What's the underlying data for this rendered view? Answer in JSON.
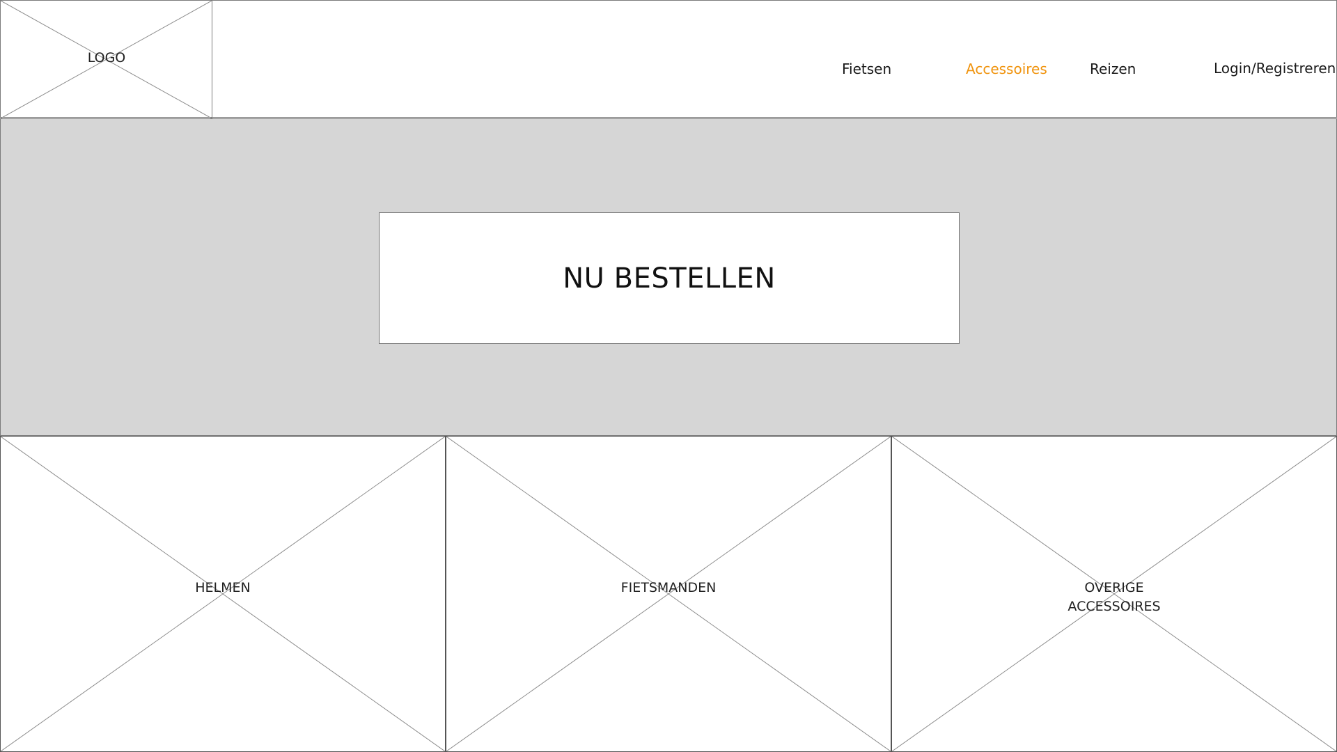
{
  "header": {
    "logo_label": "LOGO",
    "nav": {
      "fietsen": "Fietsen",
      "accessoires": "Accessoires",
      "reizen": "Reizen",
      "login": "Login/Registreren"
    },
    "active_nav": "Accessoires",
    "active_color": "#f0940f"
  },
  "hero": {
    "cta_label": "NU BESTELLEN",
    "background_color": "#d6d6d6"
  },
  "categories": [
    {
      "label_line1": "HELMEN",
      "label_line2": ""
    },
    {
      "label_line1": "FIETSMANDEN",
      "label_line2": ""
    },
    {
      "label_line1": "OVERIGE",
      "label_line2": "ACCESSOIRES"
    }
  ],
  "icons": {
    "image_placeholder": "image-placeholder-cross-icon"
  }
}
